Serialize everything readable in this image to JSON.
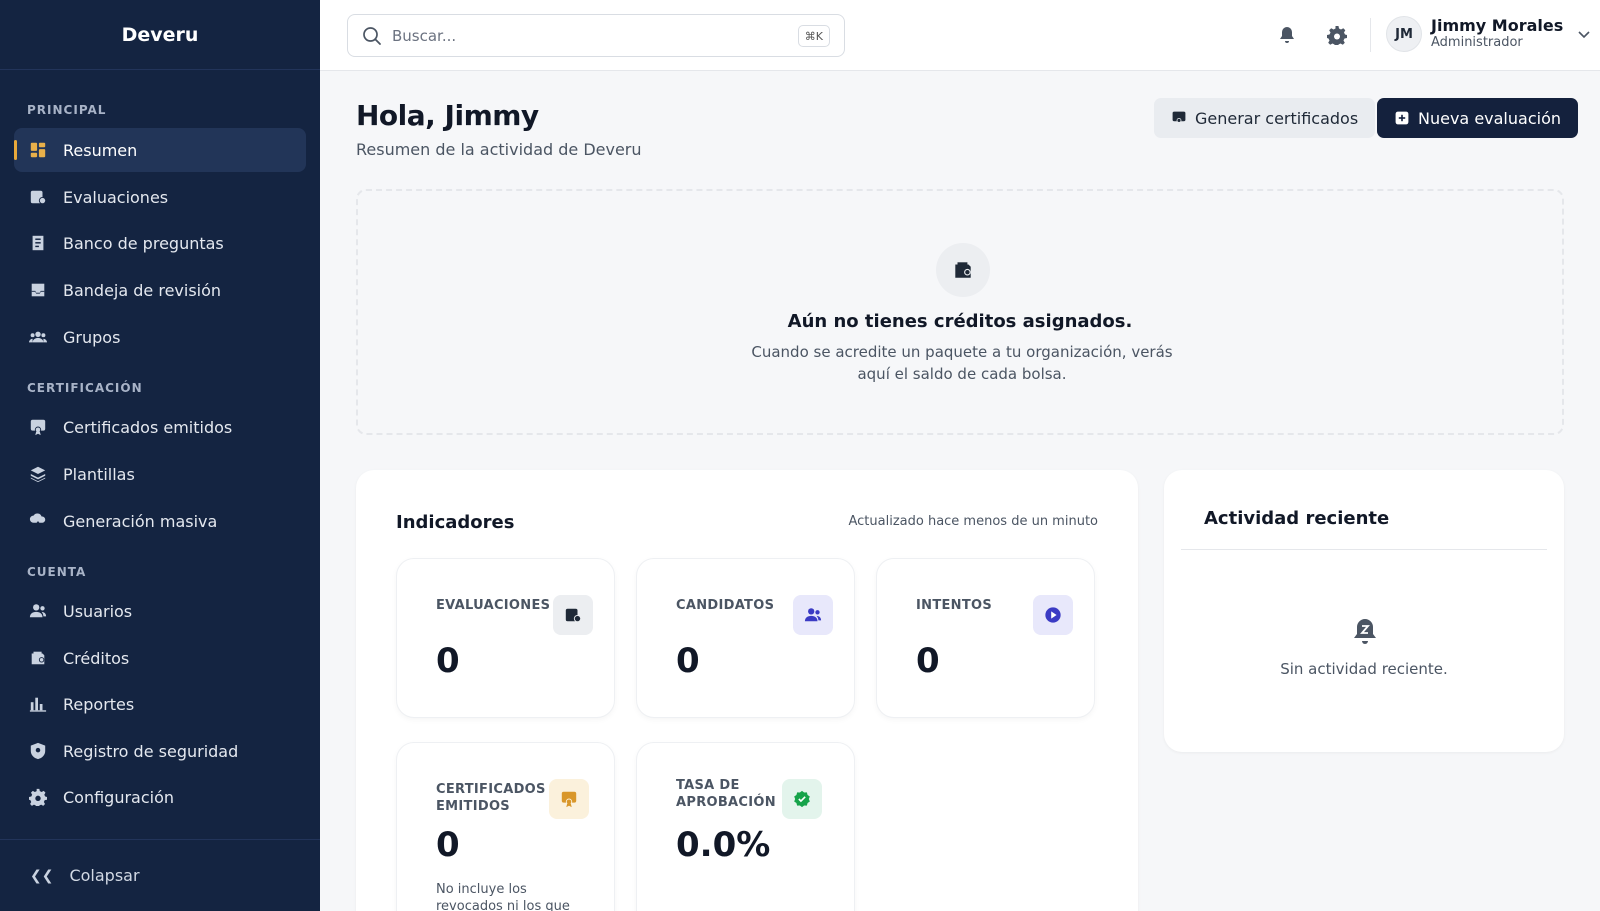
{
  "brand": "Deveru",
  "sidebar": {
    "sections": [
      {
        "label": "PRINCIPAL"
      },
      {
        "label": "CERTIFICACIÓN"
      },
      {
        "label": "CUENTA"
      }
    ],
    "items": [
      {
        "label": "Resumen",
        "icon": "dashboard-icon",
        "active": true
      },
      {
        "label": "Evaluaciones",
        "icon": "assessment-icon"
      },
      {
        "label": "Banco de preguntas",
        "icon": "question-bank-icon"
      },
      {
        "label": "Bandeja de revisión",
        "icon": "inbox-icon"
      },
      {
        "label": "Grupos",
        "icon": "groups-icon"
      },
      {
        "label": "Certificados emitidos",
        "icon": "certificate-icon"
      },
      {
        "label": "Plantillas",
        "icon": "layers-icon"
      },
      {
        "label": "Generación masiva",
        "icon": "bulk-generate-icon"
      },
      {
        "label": "Usuarios",
        "icon": "users-icon"
      },
      {
        "label": "Créditos",
        "icon": "wallet-icon"
      },
      {
        "label": "Reportes",
        "icon": "bar-chart-icon"
      },
      {
        "label": "Registro de seguridad",
        "icon": "shield-icon"
      },
      {
        "label": "Configuración",
        "icon": "gear-icon"
      }
    ],
    "collapse_label": "Colapsar"
  },
  "topbar": {
    "search_placeholder": "Buscar...",
    "search_shortcut": "⌘K",
    "user": {
      "initials": "JM",
      "name": "Jimmy Morales",
      "role": "Administrador"
    }
  },
  "main": {
    "greeting": "Hola, Jimmy",
    "subtitle": "Resumen de la actividad de Deveru",
    "buttons": {
      "generate": "Generar certificados",
      "new_eval": "Nueva evaluación"
    },
    "credits_empty": {
      "title": "Aún no tienes créditos asignados.",
      "desc": "Cuando se acredite un paquete a tu organización, verás aquí el saldo de cada bolsa."
    },
    "indicators": {
      "title": "Indicadores",
      "updated": "Actualizado hace menos de un minuto",
      "stats": [
        {
          "label": "EVALUACIONES",
          "value": "0",
          "icon": "assessment-icon",
          "color": "#eceef1"
        },
        {
          "label": "CANDIDATOS",
          "value": "0",
          "icon": "users-icon",
          "color": "#e8e8fb"
        },
        {
          "label": "INTENTOS",
          "value": "0",
          "icon": "play-icon",
          "color": "#e8e8fb"
        },
        {
          "label": "CERTIFICADOS EMITIDOS",
          "value": "0",
          "icon": "certificate-icon",
          "color": "#fbf1dc",
          "note": "No incluye los revocados ni los que"
        },
        {
          "label": "TASA DE APROBACIÓN",
          "value": "0.0%",
          "icon": "check-badge-icon",
          "color": "#e3f4ec"
        }
      ]
    },
    "activity": {
      "title": "Actividad reciente",
      "empty": "Sin actividad reciente."
    }
  },
  "colors": {
    "sidebar": "#142441",
    "accent": "#e9a93b",
    "primary_button": "#14213d"
  }
}
